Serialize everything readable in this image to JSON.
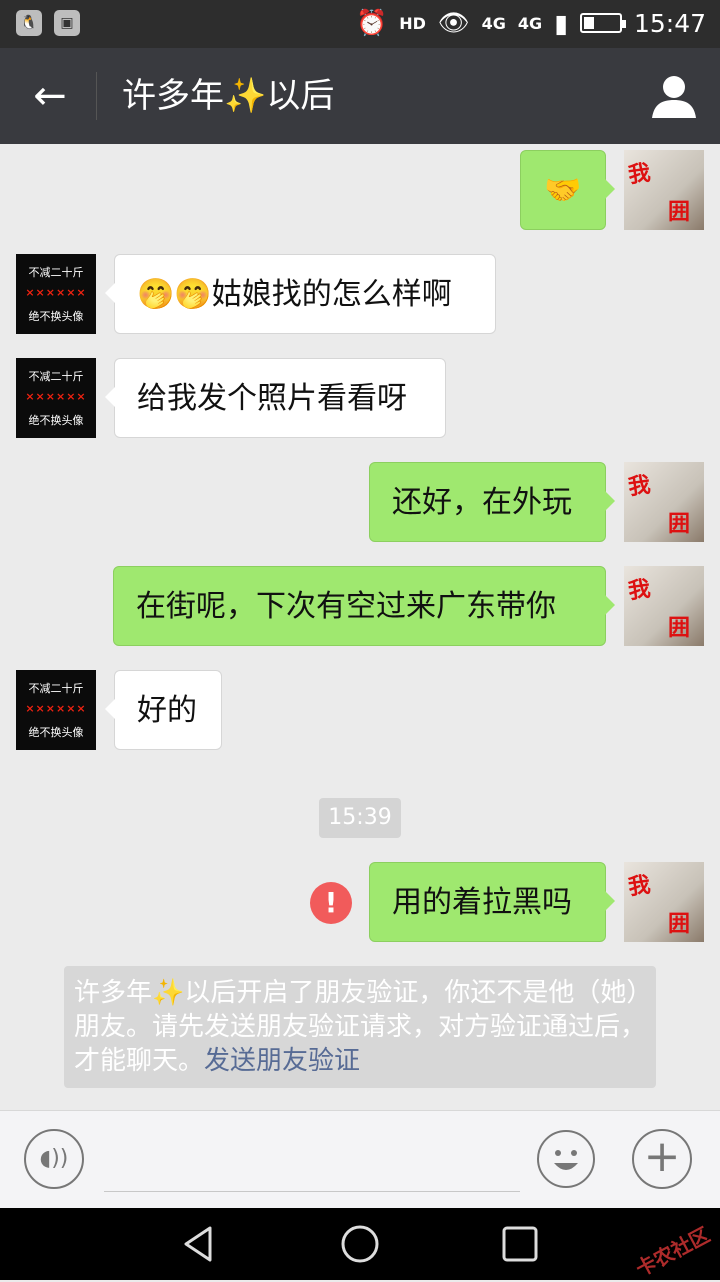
{
  "status_bar": {
    "left_icons": [
      "qq-icon",
      "image-icon"
    ],
    "hd": "HD",
    "network": "4G",
    "network_small": "4G",
    "battery_level": 0.3,
    "time": "15:47"
  },
  "header": {
    "title": "许多年✨以后"
  },
  "avatars": {
    "left_line1": "不减二十斤",
    "left_line2": "××××××",
    "left_line3": "绝不换头像",
    "right_line1": "我",
    "right_line2": "囲"
  },
  "messages": [
    {
      "side": "right",
      "text": "🤝"
    },
    {
      "side": "left",
      "text": "🤭🤭姑娘找的怎么样啊"
    },
    {
      "side": "left",
      "text": "给我发个照片看看呀"
    },
    {
      "side": "right",
      "text": "还好，在外玩"
    },
    {
      "side": "right",
      "text": "在街呢，下次有空过来广东带你"
    },
    {
      "side": "left",
      "text": "好的"
    },
    {
      "side": "right",
      "text": "用的着拉黑吗"
    }
  ],
  "timestamp": "15:39",
  "error_mark": "!",
  "system_notice": {
    "text": "许多年✨以后开启了朋友验证，你还不是他（她）朋友。请先发送朋友验证请求，对方验证通过后，才能聊天。",
    "link": "发送朋友验证"
  },
  "input_bar": {
    "plus": "+"
  },
  "watermark": "卡农社区"
}
